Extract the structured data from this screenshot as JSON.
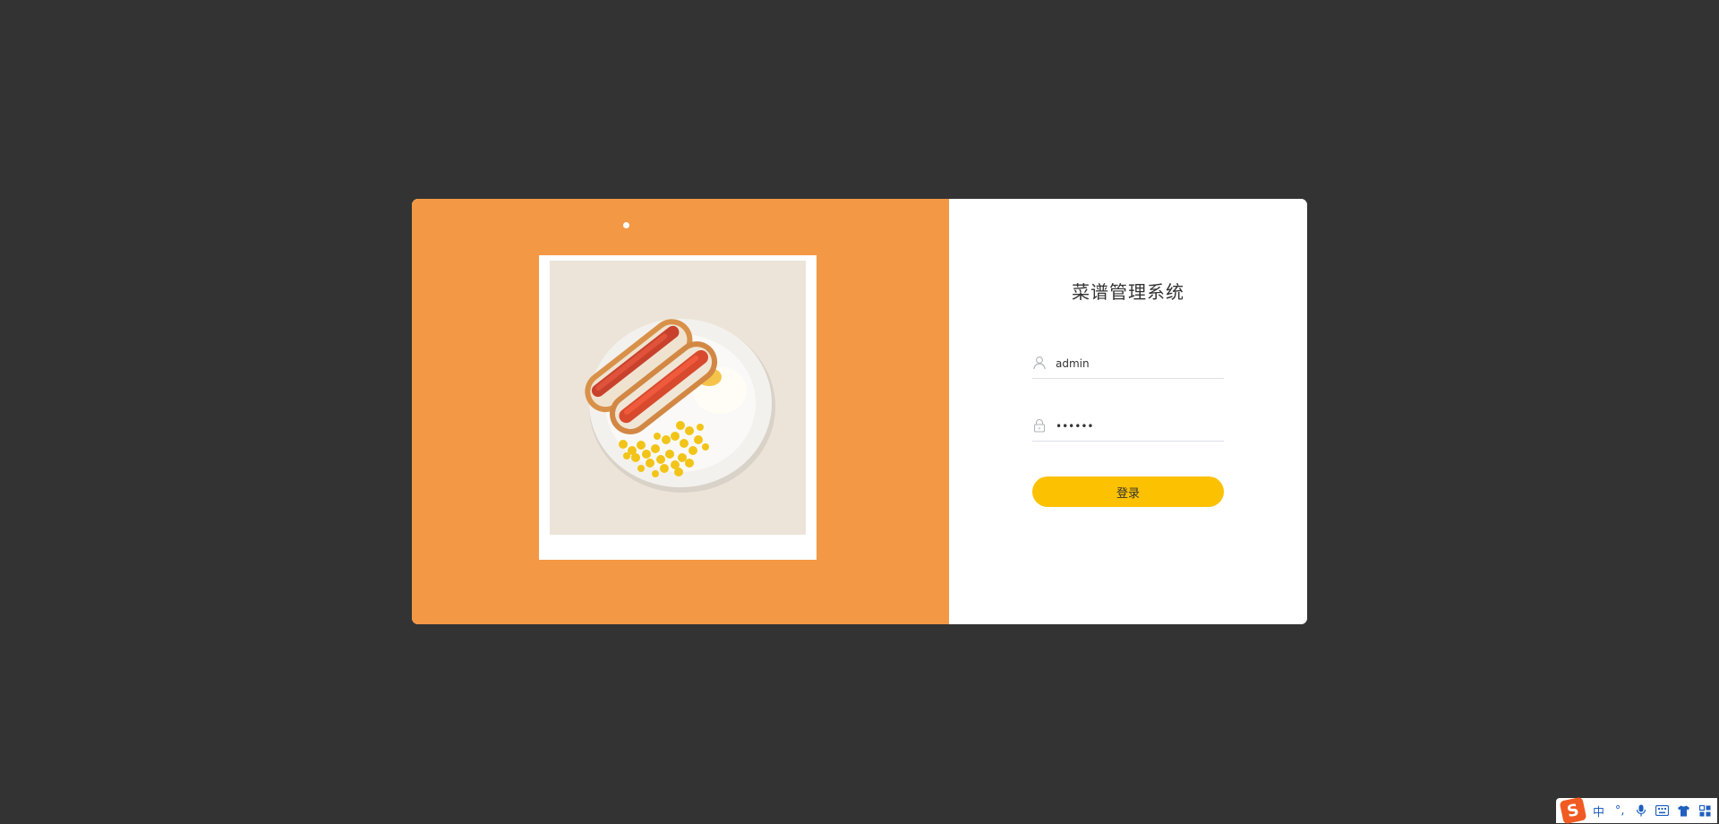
{
  "login": {
    "title": "菜谱管理系统",
    "username_value": "admin",
    "password_value": "111111",
    "submit_label": "登录"
  },
  "banner": {
    "image": "hotdog-plate-photo",
    "active_slide": 1,
    "slide_count": 1
  },
  "ime_toolbar": {
    "language_label": "中",
    "punctuation_label": "°,",
    "icons": [
      "sogou-logo-icon",
      "microphone-icon",
      "keyboard-icon",
      "shirt-skin-icon",
      "grid-toolbox-icon"
    ]
  },
  "colors": {
    "background": "#333333",
    "banner": "#f39845",
    "button": "#fcc100",
    "card": "#ffffff"
  }
}
